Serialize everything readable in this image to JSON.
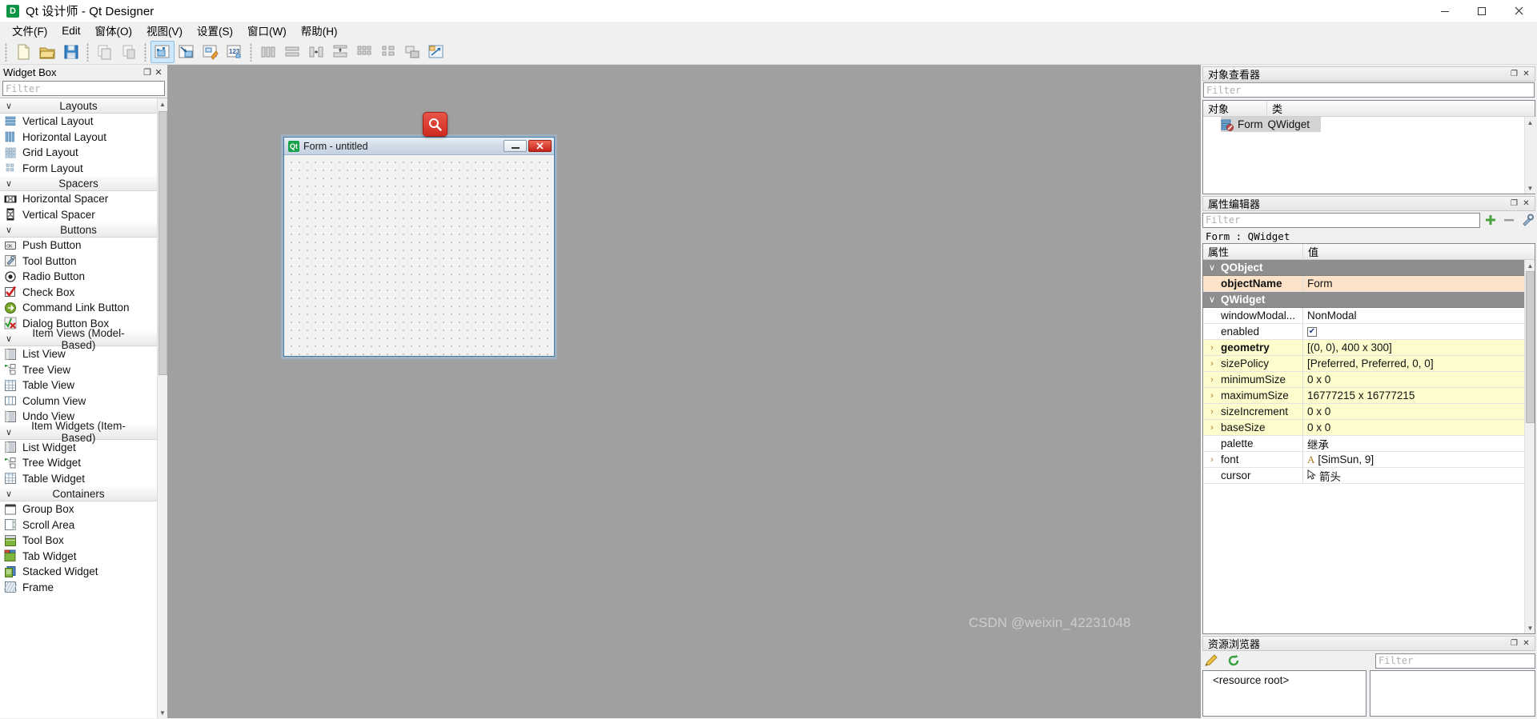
{
  "titlebar": {
    "icon": "designer-logo-icon",
    "icon_letter": "D",
    "title": "Qt 设计师 - Qt Designer",
    "minimize_label": "–",
    "maximize_label": "❐",
    "close_label": "✕"
  },
  "menubar": {
    "items": [
      {
        "label": "文件(F)",
        "name": "menu-file"
      },
      {
        "label": "Edit",
        "name": "menu-edit"
      },
      {
        "label": "窗体(O)",
        "name": "menu-form"
      },
      {
        "label": "视图(V)",
        "name": "menu-view"
      },
      {
        "label": "设置(S)",
        "name": "menu-settings"
      },
      {
        "label": "窗口(W)",
        "name": "menu-window"
      },
      {
        "label": "帮助(H)",
        "name": "menu-help"
      }
    ]
  },
  "toolbar": {
    "groups": [
      {
        "buttons": [
          {
            "name": "new-form-button",
            "icon": "new-document-icon",
            "active": false
          },
          {
            "name": "open-form-button",
            "icon": "open-folder-icon",
            "active": false
          },
          {
            "name": "save-form-button",
            "icon": "floppy-save-icon",
            "active": false
          }
        ]
      },
      {
        "buttons": [
          {
            "name": "copy-button",
            "icon": "copy-icon",
            "active": false
          },
          {
            "name": "paste-button",
            "icon": "paste-icon",
            "active": false
          }
        ]
      },
      {
        "buttons": [
          {
            "name": "edit-widgets-mode-button",
            "icon": "edit-widgets-icon",
            "active": true
          },
          {
            "name": "edit-signals-slots-mode-button",
            "icon": "signals-slots-icon",
            "active": false
          },
          {
            "name": "edit-buddies-mode-button",
            "icon": "edit-buddies-icon",
            "active": false
          },
          {
            "name": "edit-tab-order-mode-button",
            "icon": "tab-order-icon",
            "active": false
          }
        ]
      },
      {
        "buttons": [
          {
            "name": "layout-horizontally-button",
            "icon": "layout-horizontal-icon",
            "active": false
          },
          {
            "name": "layout-vertically-button",
            "icon": "layout-vertical-icon",
            "active": false
          },
          {
            "name": "layout-splitter-horizontal-button",
            "icon": "splitter-horizontal-icon",
            "active": false
          },
          {
            "name": "layout-splitter-vertical-button",
            "icon": "splitter-vertical-icon",
            "active": false
          },
          {
            "name": "layout-grid-button",
            "icon": "layout-grid-icon",
            "active": false
          },
          {
            "name": "layout-form-button",
            "icon": "layout-form-icon",
            "active": false
          },
          {
            "name": "break-layout-button",
            "icon": "break-layout-icon",
            "active": false
          },
          {
            "name": "adjust-size-button",
            "icon": "adjust-size-icon",
            "active": false
          }
        ]
      }
    ]
  },
  "widget_box": {
    "title": "Widget Box",
    "float_label": "❐",
    "close_label": "✕",
    "filter_placeholder": "Filter",
    "chevron": "∨",
    "categories": [
      {
        "label": "Layouts",
        "items": [
          {
            "label": "Vertical Layout",
            "icon": "vertical-layout-icon"
          },
          {
            "label": "Horizontal Layout",
            "icon": "horizontal-layout-icon"
          },
          {
            "label": "Grid Layout",
            "icon": "grid-layout-icon"
          },
          {
            "label": "Form Layout",
            "icon": "form-layout-icon"
          }
        ]
      },
      {
        "label": "Spacers",
        "items": [
          {
            "label": "Horizontal Spacer",
            "icon": "horizontal-spacer-icon"
          },
          {
            "label": "Vertical Spacer",
            "icon": "vertical-spacer-icon"
          }
        ]
      },
      {
        "label": "Buttons",
        "items": [
          {
            "label": "Push Button",
            "icon": "push-button-icon"
          },
          {
            "label": "Tool Button",
            "icon": "tool-button-icon"
          },
          {
            "label": "Radio Button",
            "icon": "radio-button-icon"
          },
          {
            "label": "Check Box",
            "icon": "check-box-icon"
          },
          {
            "label": "Command Link Button",
            "icon": "command-link-button-icon"
          },
          {
            "label": "Dialog Button Box",
            "icon": "dialog-button-box-icon"
          }
        ]
      },
      {
        "label": "Item Views (Model-Based)",
        "items": [
          {
            "label": "List View",
            "icon": "list-view-icon"
          },
          {
            "label": "Tree View",
            "icon": "tree-view-icon"
          },
          {
            "label": "Table View",
            "icon": "table-view-icon"
          },
          {
            "label": "Column View",
            "icon": "column-view-icon"
          },
          {
            "label": "Undo View",
            "icon": "undo-view-icon"
          }
        ]
      },
      {
        "label": "Item Widgets (Item-Based)",
        "items": [
          {
            "label": "List Widget",
            "icon": "list-widget-icon"
          },
          {
            "label": "Tree Widget",
            "icon": "tree-widget-icon"
          },
          {
            "label": "Table Widget",
            "icon": "table-widget-icon"
          }
        ]
      },
      {
        "label": "Containers",
        "items": [
          {
            "label": "Group Box",
            "icon": "group-box-icon"
          },
          {
            "label": "Scroll Area",
            "icon": "scroll-area-icon"
          },
          {
            "label": "Tool Box",
            "icon": "tool-box-icon"
          },
          {
            "label": "Tab Widget",
            "icon": "tab-widget-icon"
          },
          {
            "label": "Stacked Widget",
            "icon": "stacked-widget-icon"
          },
          {
            "label": "Frame",
            "icon": "frame-icon"
          }
        ]
      }
    ]
  },
  "canvas": {
    "form": {
      "icon": "qt-logo-icon",
      "icon_letter": "Qt",
      "title": "Form - untitled",
      "minimize_label": "—",
      "close_label": "✕"
    },
    "search_badge": {
      "icon": "search-icon"
    },
    "watermark": "CSDN @weixin_42231048"
  },
  "object_inspector": {
    "title": "对象查看器",
    "float_label": "❐",
    "close_label": "✕",
    "filter_placeholder": "Filter",
    "columns": [
      "对象",
      "类"
    ],
    "rows": [
      {
        "name": "Form",
        "class": "QWidget",
        "icon": "widget-node-icon",
        "selected": true
      }
    ]
  },
  "property_editor": {
    "title": "属性编辑器",
    "float_label": "❐",
    "close_label": "✕",
    "filter_placeholder": "Filter",
    "add_label": "+",
    "remove_label": "–",
    "configure_label": "configure-icon",
    "object_line": "Form : QWidget",
    "columns": [
      "属性",
      "值"
    ],
    "groups": [
      {
        "label": "QObject",
        "chevron": "∨",
        "rows": [
          {
            "name": "objectName",
            "value": "Form",
            "bold": true,
            "expand": "",
            "bg": "orange"
          }
        ]
      },
      {
        "label": "QWidget",
        "chevron": "∨",
        "rows": [
          {
            "name": "windowModal...",
            "value": "NonModal",
            "bold": false,
            "expand": "",
            "bg": "white"
          },
          {
            "name": "enabled",
            "value": "",
            "checkbox": true,
            "bold": false,
            "expand": "",
            "bg": "white"
          },
          {
            "name": "geometry",
            "value": "[(0, 0), 400 x 300]",
            "bold": true,
            "expand": "›",
            "bg": "yellow"
          },
          {
            "name": "sizePolicy",
            "value": "[Preferred, Preferred, 0, 0]",
            "bold": false,
            "expand": "›",
            "bg": "yellow"
          },
          {
            "name": "minimumSize",
            "value": "0 x 0",
            "bold": false,
            "expand": "›",
            "bg": "yellow"
          },
          {
            "name": "maximumSize",
            "value": "16777215 x 16777215",
            "bold": false,
            "expand": "›",
            "bg": "yellow"
          },
          {
            "name": "sizeIncrement",
            "value": "0 x 0",
            "bold": false,
            "expand": "›",
            "bg": "yellow"
          },
          {
            "name": "baseSize",
            "value": "0 x 0",
            "bold": false,
            "expand": "›",
            "bg": "yellow"
          },
          {
            "name": "palette",
            "value": "继承",
            "bold": false,
            "expand": "",
            "bg": "white"
          },
          {
            "name": "font",
            "value": "[SimSun, 9]",
            "icon": "font-A-icon",
            "bold": false,
            "expand": "›",
            "bg": "white"
          },
          {
            "name": "cursor",
            "value": "箭头",
            "icon": "cursor-arrow-icon",
            "bold": false,
            "expand": "",
            "bg": "white"
          }
        ]
      }
    ]
  },
  "resource_browser": {
    "title": "资源浏览器",
    "float_label": "❐",
    "close_label": "✕",
    "edit_label": "pencil-edit-icon",
    "reload_label": "reload-icon",
    "filter_placeholder": "Filter",
    "root_label": "<resource root>"
  },
  "colors": {
    "accent_blue": "#cde8ff",
    "canvas_gray": "#a0a0a0",
    "group_header": "#8e8e8e",
    "prop_orange": "#fce3c8",
    "prop_yellow": "#fdfccd",
    "badge_red": "#cf2a20",
    "close_red": "#c3231a"
  }
}
